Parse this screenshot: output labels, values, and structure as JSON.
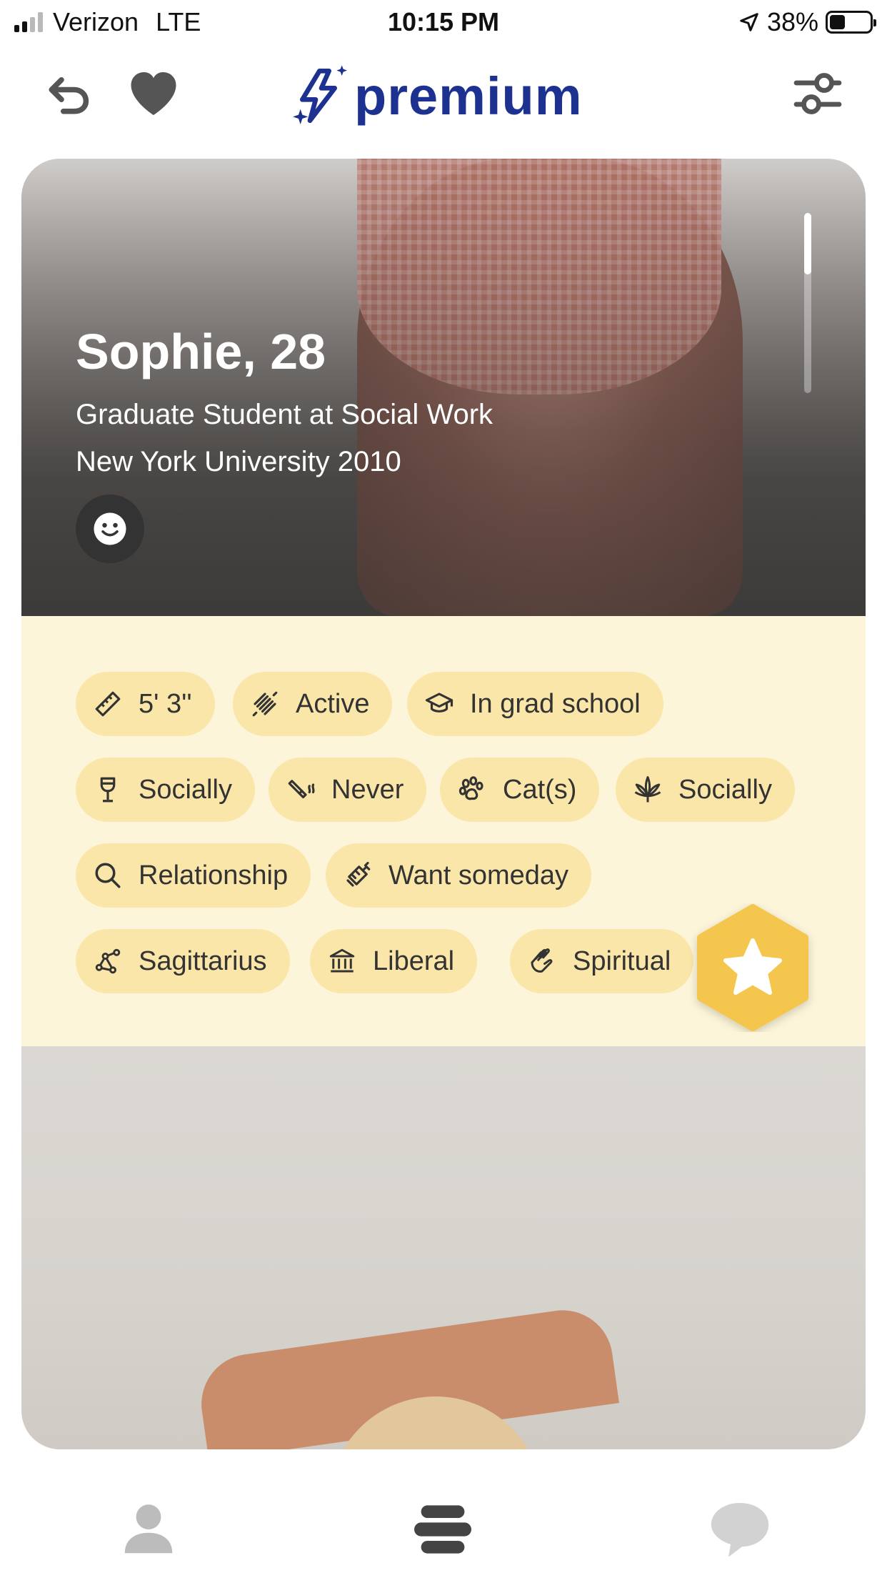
{
  "status_bar": {
    "carrier": "Verizon",
    "network": "LTE",
    "time": "10:15 PM",
    "battery": "38%",
    "battery_level": 0.38,
    "signal_bars": 2,
    "icons": [
      "signal-icon",
      "location-arrow-icon",
      "battery-icon"
    ]
  },
  "header": {
    "brand": "premium",
    "icons": [
      "undo-icon",
      "heart-icon",
      "bolt-icon",
      "filter-icon"
    ],
    "brand_color": "#1d3290"
  },
  "profile": {
    "name_age": "Sophie, 28",
    "job": "Graduate Student at Social Work",
    "school": "New York University 2010",
    "emoji_icon": "smile-icon"
  },
  "attributes": [
    {
      "label": "5' 3''",
      "icon": "ruler-icon"
    },
    {
      "label": "Active",
      "icon": "dumbbell-icon"
    },
    {
      "label": "In grad school",
      "icon": "graduation-cap-icon"
    },
    {
      "label": "Socially",
      "icon": "wine-glass-icon"
    },
    {
      "label": "Never",
      "icon": "cigarette-icon"
    },
    {
      "label": "Cat(s)",
      "icon": "paw-icon"
    },
    {
      "label": "Socially",
      "icon": "cannabis-leaf-icon"
    },
    {
      "label": "Relationship",
      "icon": "search-icon"
    },
    {
      "label": "Want someday",
      "icon": "baby-bottle-icon"
    },
    {
      "label": "Sagittarius",
      "icon": "constellation-icon"
    },
    {
      "label": "Liberal",
      "icon": "government-building-icon"
    },
    {
      "label": "Spiritual",
      "icon": "praying-hands-icon"
    }
  ],
  "actions": {
    "superlike_icon": "star-icon",
    "superlike_color": "#f5c64d"
  },
  "tabbar": {
    "icons": [
      "profile-icon",
      "discover-icon",
      "chat-icon"
    ]
  },
  "colors": {
    "info_background": "#fdf5d9",
    "chip_background": "#fbe6a9"
  }
}
